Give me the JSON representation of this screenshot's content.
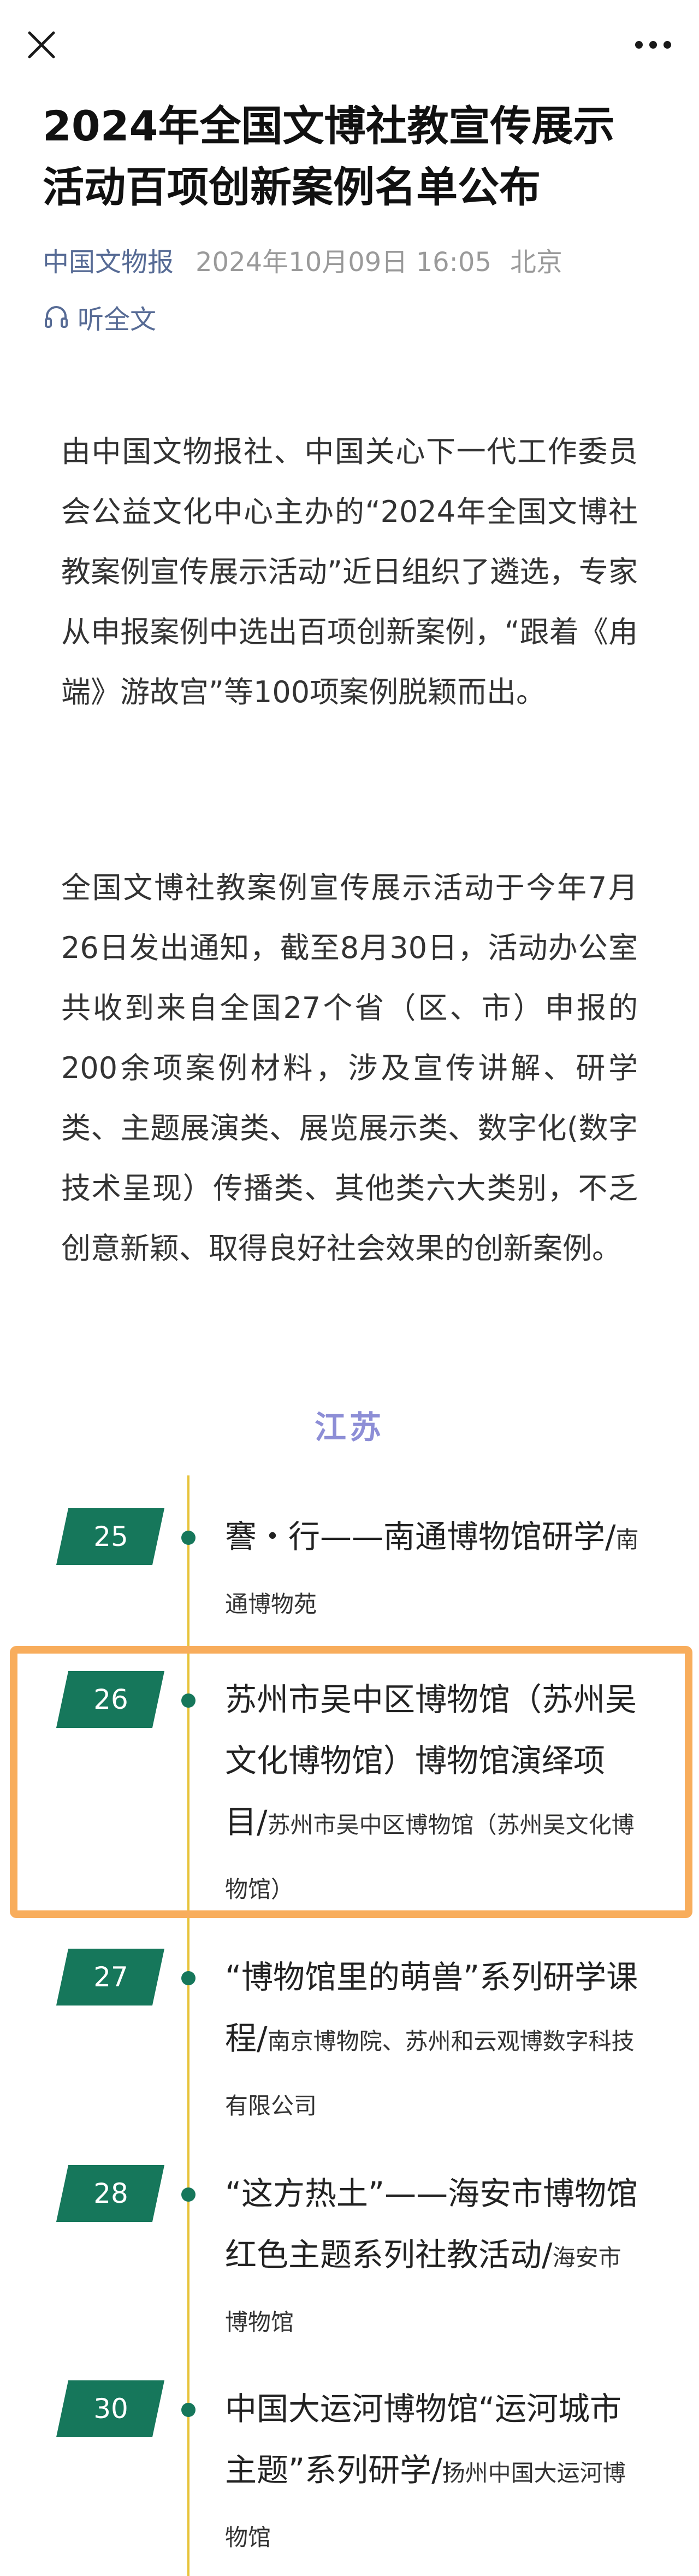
{
  "header": {
    "close_icon": "close-icon",
    "more_icon": "more-dots-icon"
  },
  "article": {
    "title": "2024年全国文博社教宣传展示活动百项创新案例名单公布",
    "source": "中国文物报",
    "datetime": "2024年10月09日 16:05",
    "location": "北京",
    "listen_label": "听全文",
    "paragraphs": [
      "由中国文物报社、中国关心下一代工作委员会公益文化中心主办的“2024年全国文博社教案例宣传展示活动”近日组织了遴选，专家从申报案例中选出百项创新案例，“跟着《甪端》游故宫”等100项案例脱颖而出。",
      "全国文博社教案例宣传展示活动于今年7月26日发出通知，截至8月30日，活动办公室共收到来自全国27个省（区、市）申报的200余项案例材料，涉及宣传讲解、研学类、主题展演类、展览展示类、数字化(数字技术呈现）传播类、其他类六大类别，不乏创意新颖、取得良好社会效果的创新案例。"
    ],
    "region": "江苏"
  },
  "cases": [
    {
      "num": "25",
      "title": "謇・行——南通博物馆研学",
      "institution": "南通博物苑"
    },
    {
      "num": "26",
      "title": "苏州市吴中区博物馆（苏州吴文化博物馆）博物馆演绎项目",
      "institution": "苏州市吴中区博物馆（苏州吴文化博物馆）"
    },
    {
      "num": "27",
      "title": "“博物馆里的萌兽”系列研学课程",
      "institution": "南京博物院、苏州和云观博数字科技有限公司"
    },
    {
      "num": "28",
      "title": "“这方热土”——海安市博物馆红色主题系列社教活动",
      "institution": "海安市博物馆"
    },
    {
      "num": "30",
      "title": "中国大运河博物馆“运河城市主题”系列研学",
      "institution": "扬州中国大运河博物馆"
    }
  ],
  "colors": {
    "accent_link": "#576b95",
    "badge_green": "#16775b",
    "timeline_yellow": "#e7c33a",
    "region_text": "#8d8ed6",
    "highlight_orange": "#f8ad5c"
  }
}
